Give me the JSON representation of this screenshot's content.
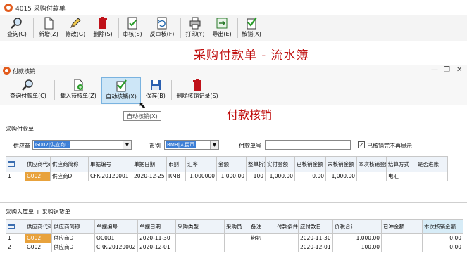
{
  "window": {
    "title": "4015 采购付款单"
  },
  "toolbar_main": [
    {
      "label": "查询(C)",
      "icon": "magnifier-icon"
    },
    {
      "label": "新增(Z)",
      "icon": "new-document-icon"
    },
    {
      "label": "修改(G)",
      "icon": "edit-pencil-icon"
    },
    {
      "label": "删除(S)",
      "icon": "trash-icon"
    },
    {
      "label": "审核(S)",
      "icon": "approve-icon"
    },
    {
      "label": "反审核(F)",
      "icon": "unapprove-icon"
    },
    {
      "label": "打印(Y)",
      "icon": "printer-icon"
    },
    {
      "label": "导出(E)",
      "icon": "export-icon"
    },
    {
      "label": "核销(X)",
      "icon": "verify-icon"
    }
  ],
  "annotation_ledger": "采购付款单 - 流水簿",
  "inner_window": {
    "title": "付款核销"
  },
  "toolbar_inner": [
    {
      "label": "查询付款单(C)",
      "icon": "magnifier-icon"
    },
    {
      "label": "载入待核单(Z)",
      "icon": "load-document-icon"
    },
    {
      "label": "自动核销(X)",
      "icon": "auto-verify-icon"
    },
    {
      "label": "保存(B)",
      "icon": "save-icon"
    },
    {
      "label": "删除核销记录(S)",
      "icon": "trash-icon"
    }
  ],
  "tooltip": "自动核销(X)",
  "annotation_verify": "付款核销",
  "payment_section": {
    "title": "采购付款单",
    "supplier_label": "供应商",
    "supplier_value": "G002|供应商D",
    "currency_label": "币别",
    "currency_value": "RMB|人民币",
    "payno_label": "付款单号",
    "payno_value": "",
    "hide_checkbox_label": "已核销完不再显示",
    "hide_checked": true
  },
  "payment_table": {
    "headers": [
      "供应商代码",
      "供应商简称",
      "单据编号",
      "单据日期",
      "币别",
      "汇率",
      "金额",
      "整单折扣",
      "实付金额",
      "已核销金额",
      "未核销金额",
      "本次核销金额",
      "结算方式",
      "是否进账"
    ],
    "rows": [
      [
        "1",
        "G002",
        "供应商D",
        "CFK-20120001",
        "2020-12-25",
        "RMB",
        "1.000000",
        "1,000.00",
        "100",
        "1,000.00",
        "0.00",
        "1,000.00",
        "",
        "电汇",
        ""
      ]
    ]
  },
  "inbound_section": {
    "title": "采购入库单 + 采购退货单"
  },
  "inbound_table": {
    "headers": [
      "供应商代码",
      "供应商简称",
      "单据编号",
      "单据日期",
      "采购类型",
      "采购员",
      "备注",
      "付款条件",
      "应付款日",
      "价税合计",
      "已冲金额",
      "本次核销金额"
    ],
    "rows": [
      [
        "1",
        "G002",
        "供应商D",
        "QC001",
        "2020-11-30",
        "",
        "",
        "期初",
        "",
        "2020-11-30",
        "1,000.00",
        "",
        "0.00"
      ],
      [
        "2",
        "G002",
        "供应商D",
        "CRK-20120002",
        "2020-12-01",
        "",
        "",
        "",
        "",
        "2020-12-01",
        "100.00",
        "",
        "0.00"
      ]
    ]
  }
}
